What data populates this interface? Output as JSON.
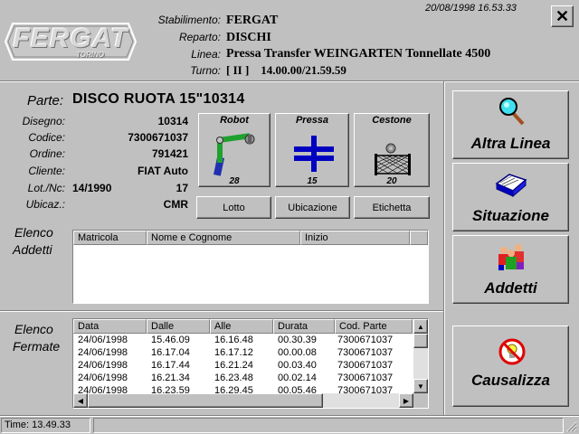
{
  "header": {
    "logo_text": "FERGAT",
    "logo_sub": "TORINO",
    "datetime": "20/08/1998 16.53.33",
    "labels": {
      "stabilimento": "Stabilimento:",
      "reparto": "Reparto:",
      "linea": "Linea:",
      "turno": "Turno:"
    },
    "stabilimento": "FERGAT",
    "reparto": "DISCHI",
    "linea": "Pressa Transfer WEINGARTEN Tonnellate 4500",
    "turno": "[ II ]    14.00.00/21.59.59",
    "close_glyph": "✕"
  },
  "part": {
    "label": "Parte:",
    "value": "DISCO RUOTA 15\"10314",
    "fields": [
      {
        "label": "Disegno:",
        "value": "10314"
      },
      {
        "label": "Codice:",
        "value": "7300671037"
      },
      {
        "label": "Ordine:",
        "value": "791421"
      },
      {
        "label": "Cliente:",
        "value": "FIAT Auto"
      },
      {
        "label": "Lot./Nc:",
        "value": "14/1990",
        "value2": "17"
      },
      {
        "label": "Ubicaz.:",
        "value": "CMR"
      }
    ]
  },
  "tiles": [
    {
      "title": "Robot",
      "count": "28",
      "icon": "robot-arm-icon"
    },
    {
      "title": "Pressa",
      "count": "15",
      "icon": "press-icon"
    },
    {
      "title": "Cestone",
      "count": "20",
      "icon": "basket-icon"
    }
  ],
  "small_buttons": {
    "lotto": "Lotto",
    "ubicazione": "Ubicazione",
    "etichetta": "Etichetta"
  },
  "addetti": {
    "label_line1": "Elenco",
    "label_line2": "Addetti",
    "columns": [
      "Matricola",
      "Nome e Cognome",
      "Inizio"
    ],
    "rows": []
  },
  "fermate": {
    "label_line1": "Elenco",
    "label_line2": "Fermate",
    "columns": [
      "Data",
      "Dalle",
      "Alle",
      "Durata",
      "Cod. Parte"
    ],
    "rows": [
      [
        "24/06/1998",
        "15.46.09",
        "16.16.48",
        "00.30.39",
        "7300671037"
      ],
      [
        "24/06/1998",
        "16.17.04",
        "16.17.12",
        "00.00.08",
        "7300671037"
      ],
      [
        "24/06/1998",
        "16.17.44",
        "16.21.24",
        "00.03.40",
        "7300671037"
      ],
      [
        "24/06/1998",
        "16.21.34",
        "16.23.48",
        "00.02.14",
        "7300671037"
      ],
      [
        "24/06/1998",
        "16.23.59",
        "16.29.45",
        "00.05.46",
        "7300671037"
      ]
    ]
  },
  "side_buttons": {
    "altra_linea": "Altra Linea",
    "situazione": "Situazione",
    "addetti": "Addetti",
    "causalizza": "Causalizza"
  },
  "status": {
    "time": "Time: 13.49.33"
  },
  "colors": {
    "list_bg": "#ffffff",
    "robot_green": "#1fa02f",
    "press_blue": "#0000c0",
    "frame_gray": "#c0c0c0"
  }
}
